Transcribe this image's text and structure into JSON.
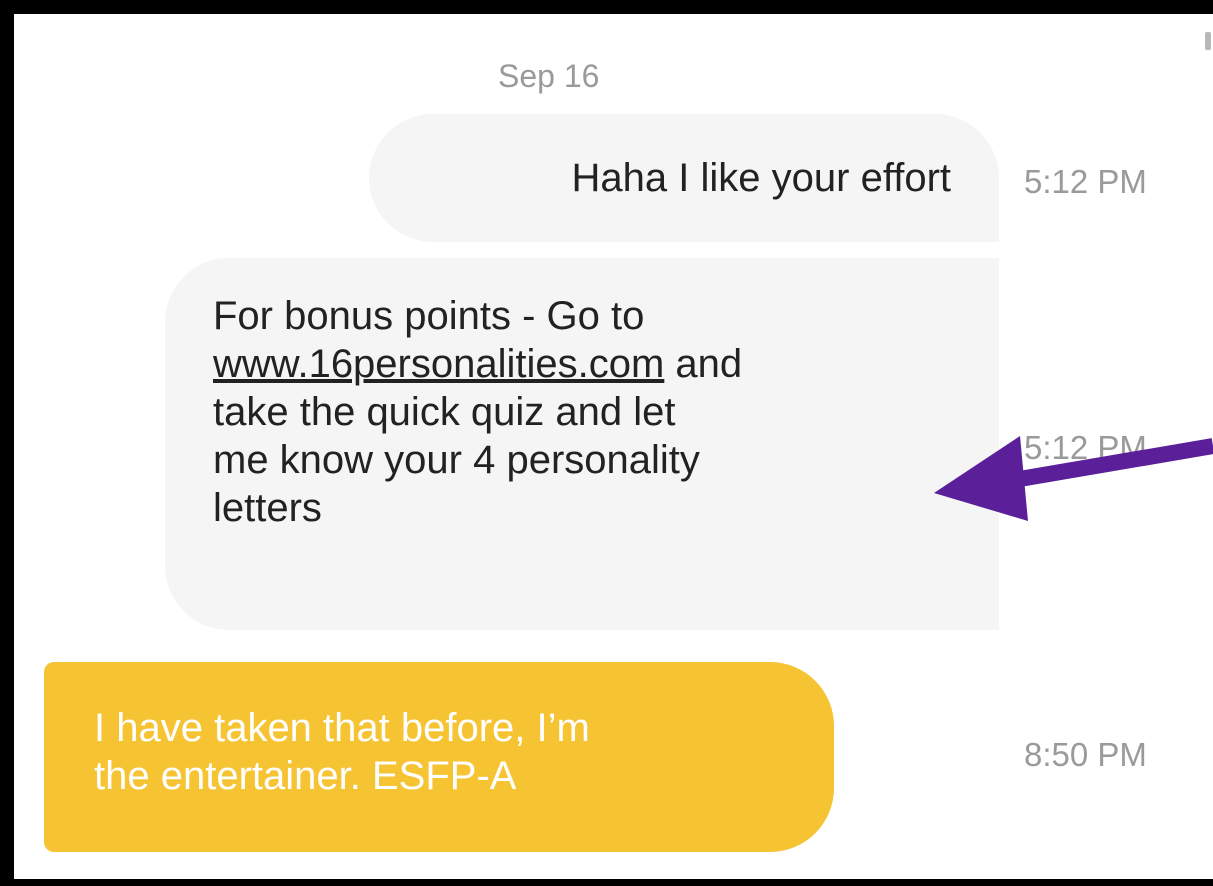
{
  "header": {
    "date": "Sep 16"
  },
  "messages": [
    {
      "text": "Haha I like your effort",
      "time": "5:12 PM"
    },
    {
      "line1": "For bonus points - Go to",
      "link": "www.16personalities.com",
      "after_link": " and",
      "line3": "take the quick quiz and let",
      "line4": "me know your 4 personality",
      "line5": "letters",
      "time": "5:12 PM"
    },
    {
      "line1": "I have taken that before, I’m",
      "line2": "the entertainer. ESFP-A",
      "time": "8:50 PM"
    }
  ],
  "annotation": {
    "icon": "arrow-left-icon",
    "color": "#5a1f99"
  },
  "colors": {
    "outgoing_bubble": "#f6c332",
    "incoming_bubble": "#f5f5f5",
    "timestamp": "#9a9a9a"
  }
}
